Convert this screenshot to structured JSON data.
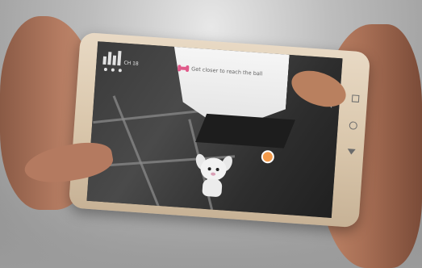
{
  "scene": {
    "type": "photo",
    "subject": "hands holding smartphone showing AR app"
  },
  "app": {
    "prompt_text": "Get closer to reach the ball",
    "hud_value": "CH 18",
    "icons": {
      "prompt_icon": "bone-icon",
      "close": "close-icon",
      "food": "food-bowl-icon",
      "back_chevron": "chevron-left-icon",
      "stats": "signal-bars-icon"
    },
    "colors": {
      "accent": "#e05a8a",
      "food": "#f39a4a"
    }
  },
  "phone_nav": {
    "icons": [
      "recent-apps-icon",
      "home-icon",
      "back-icon"
    ]
  }
}
